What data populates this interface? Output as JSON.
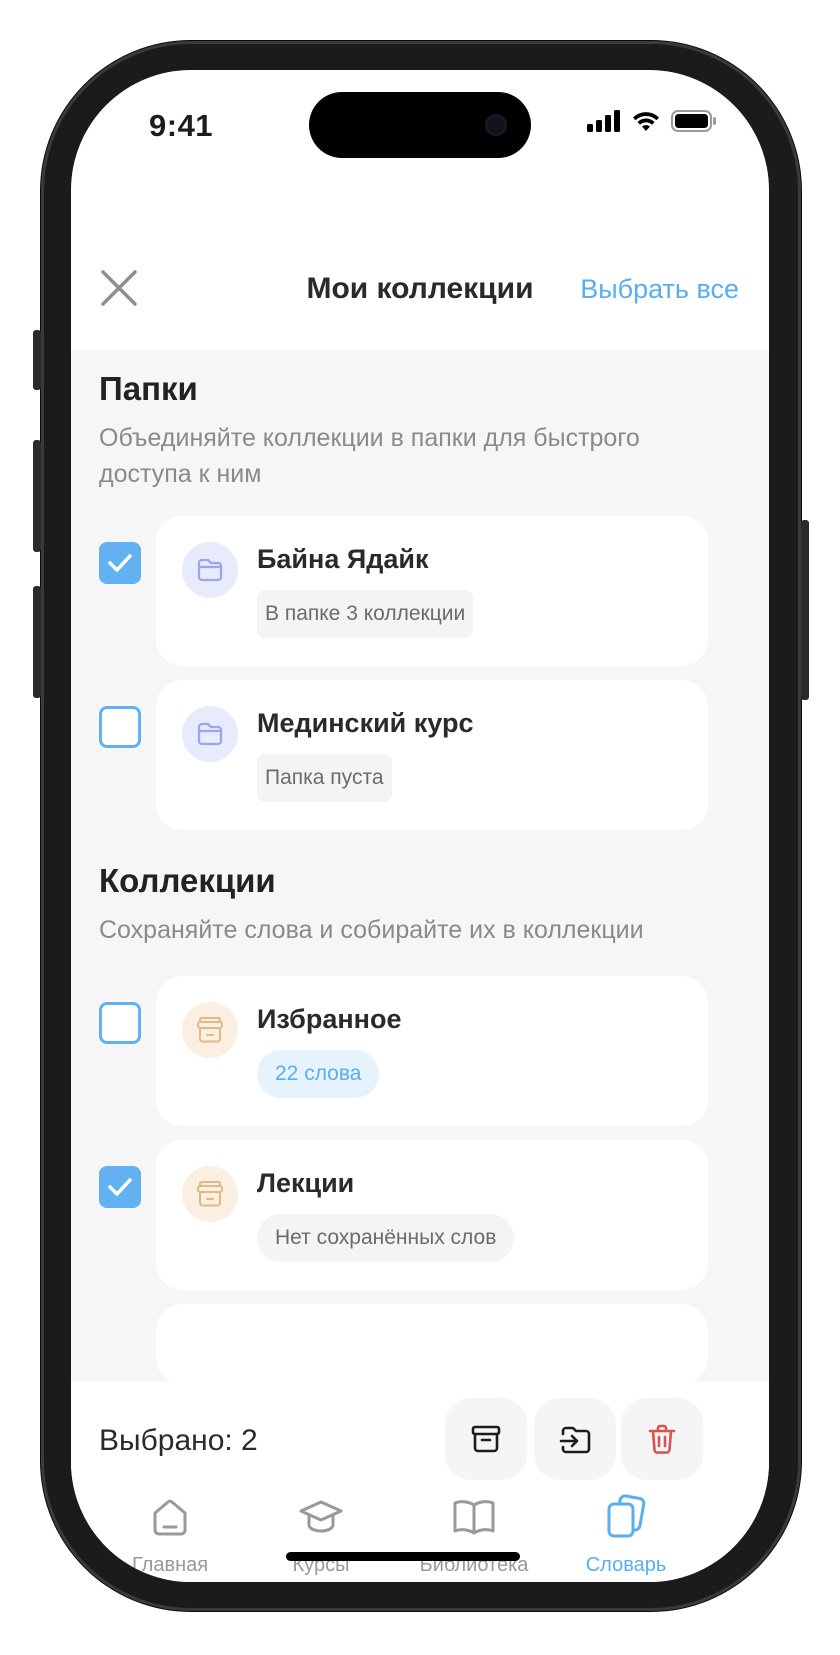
{
  "status_bar": {
    "time": "9:41"
  },
  "header": {
    "title": "Мои коллекции",
    "select_all": "Выбрать все",
    "close_icon": "close-icon"
  },
  "folders": {
    "title": "Папки",
    "subtitle": "Объединяйте коллекции в папки для быстрого доступа к ним",
    "items": [
      {
        "name": "Байна Ядайк",
        "info": "В папке 3 коллекции",
        "checked": true
      },
      {
        "name": "Мединский курс",
        "info": "Папка пуста",
        "checked": false
      }
    ]
  },
  "collections": {
    "title": "Коллекции",
    "subtitle": "Сохраняйте слова и собирайте их в коллекции",
    "items": [
      {
        "name": "Избранное",
        "info": "22 слова",
        "checked": false
      },
      {
        "name": "Лекции",
        "info": "Нет сохранённых слов",
        "checked": true
      }
    ]
  },
  "action_bar": {
    "selected_label": "Выбрано: 2",
    "actions": [
      "archive-icon",
      "move-to-folder-icon",
      "trash-icon"
    ]
  },
  "tabs": [
    {
      "label": "Главная",
      "icon": "home-icon",
      "active": false
    },
    {
      "label": "Курсы",
      "icon": "graduation-cap-icon",
      "active": false
    },
    {
      "label": "Библиотека",
      "icon": "book-icon",
      "active": false
    },
    {
      "label": "Словарь",
      "icon": "cards-icon",
      "active": true
    }
  ],
  "colors": {
    "accent": "#5aaef0",
    "danger": "#d9534f",
    "background": "#f6f6f8"
  }
}
